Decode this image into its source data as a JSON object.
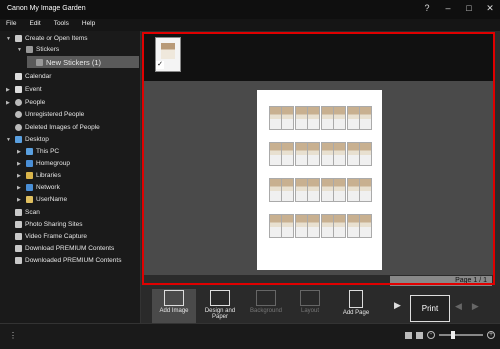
{
  "window": {
    "title": "Canon My Image Garden"
  },
  "menu": [
    "File",
    "Edit",
    "Tools",
    "Help"
  ],
  "sidebar": {
    "items": [
      {
        "label": "Create or Open Items"
      },
      {
        "label": "Stickers"
      },
      {
        "label": "New Stickers (1)"
      },
      {
        "label": "Calendar"
      },
      {
        "label": "Event"
      },
      {
        "label": "People"
      },
      {
        "label": "Unregistered People"
      },
      {
        "label": "Deleted Images of People"
      },
      {
        "label": "Desktop"
      },
      {
        "label": "This PC"
      },
      {
        "label": "Homegroup"
      },
      {
        "label": "Libraries"
      },
      {
        "label": "Network"
      },
      {
        "label": "UserName"
      },
      {
        "label": "Scan"
      },
      {
        "label": "Photo Sharing Sites"
      },
      {
        "label": "Video Frame Capture"
      },
      {
        "label": "Download PREMIUM Contents"
      },
      {
        "label": "Downloaded PREMIUM Contents"
      }
    ]
  },
  "preview": {
    "page_indicator": "Page 1 / 1",
    "checked": "✓"
  },
  "toolbar": {
    "add_image": "Add Image",
    "design_and_paper": "Design and Paper",
    "background": "Background",
    "layout": "Layout",
    "add_page": "Add Page",
    "print": "Print"
  }
}
